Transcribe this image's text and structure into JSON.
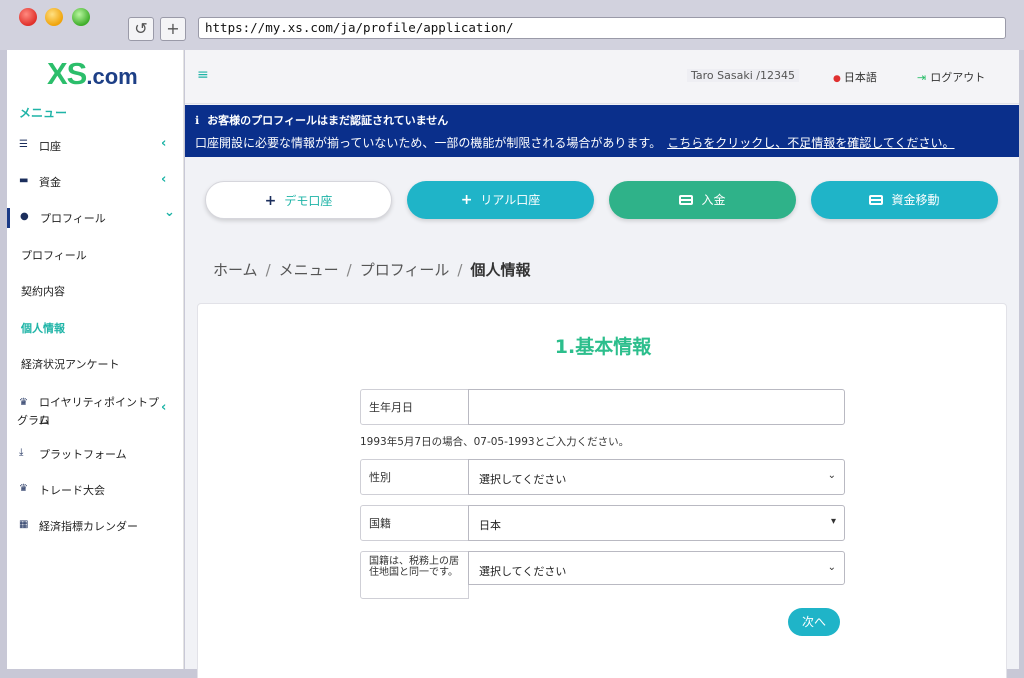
{
  "browser": {
    "url": "https://my.xs.com/ja/profile/application/",
    "reload_glyph": "↺",
    "newtab_glyph": "+"
  },
  "brand": {
    "logo_main": "XS",
    "logo_suffix": ".com",
    "colors": {
      "green": "#2cbe6b",
      "navy": "#1d3f86",
      "teal": "#1fb4a7"
    }
  },
  "sidebar": {
    "heading": "メニュー",
    "items": [
      {
        "label": "口座",
        "icon": "list-icon",
        "chevron": "‹"
      },
      {
        "label": "資金",
        "icon": "wallet-icon",
        "chevron": "‹"
      },
      {
        "label": "プロフィール",
        "icon": "user-icon",
        "chevron": "⌄"
      },
      {
        "label": "ロイヤリティポイントプロ",
        "label2": "グラム",
        "icon": "trophy-icon",
        "chevron": "‹"
      },
      {
        "label": "プラットフォーム",
        "icon": "download-icon"
      },
      {
        "label": "トレード大会",
        "icon": "trophy-icon"
      },
      {
        "label": "経済指標カレンダー",
        "icon": "calendar-icon"
      }
    ],
    "profile_sub": [
      "プロフィール",
      "契約内容",
      "個人情報",
      "経済状況アンケート"
    ]
  },
  "topbar": {
    "menu_glyph": "≡",
    "user": "Taro Sasaki /12345",
    "language": "日本語",
    "logout": "ログアウト"
  },
  "alert": {
    "title": "お客様のプロフィールはまだ認証されていません",
    "body": "口座開設に必要な情報が揃っていないため、一部の機能が制限される場合があります。",
    "link": "こちらをクリックし、不足情報を確認してください。"
  },
  "actions": {
    "demo": "デモ口座",
    "real": "リアル口座",
    "deposit": "入金",
    "transfer": "資金移動"
  },
  "breadcrumb": [
    "ホーム",
    "メニュー",
    "プロフィール",
    "個人情報"
  ],
  "form": {
    "title": "1.基本情報",
    "birthdate_label": "生年月日",
    "birthdate_value": "",
    "hint": "1993年5月7日の場合、07-05-1993とご入力ください。",
    "gender_label": "性別",
    "gender_value": "選択してください",
    "nationality_label": "国籍",
    "nationality_value": "日本",
    "tax_label": "国籍は、税務上の居住地国と同一です。",
    "tax_value": "選択してください",
    "next": "次へ"
  }
}
